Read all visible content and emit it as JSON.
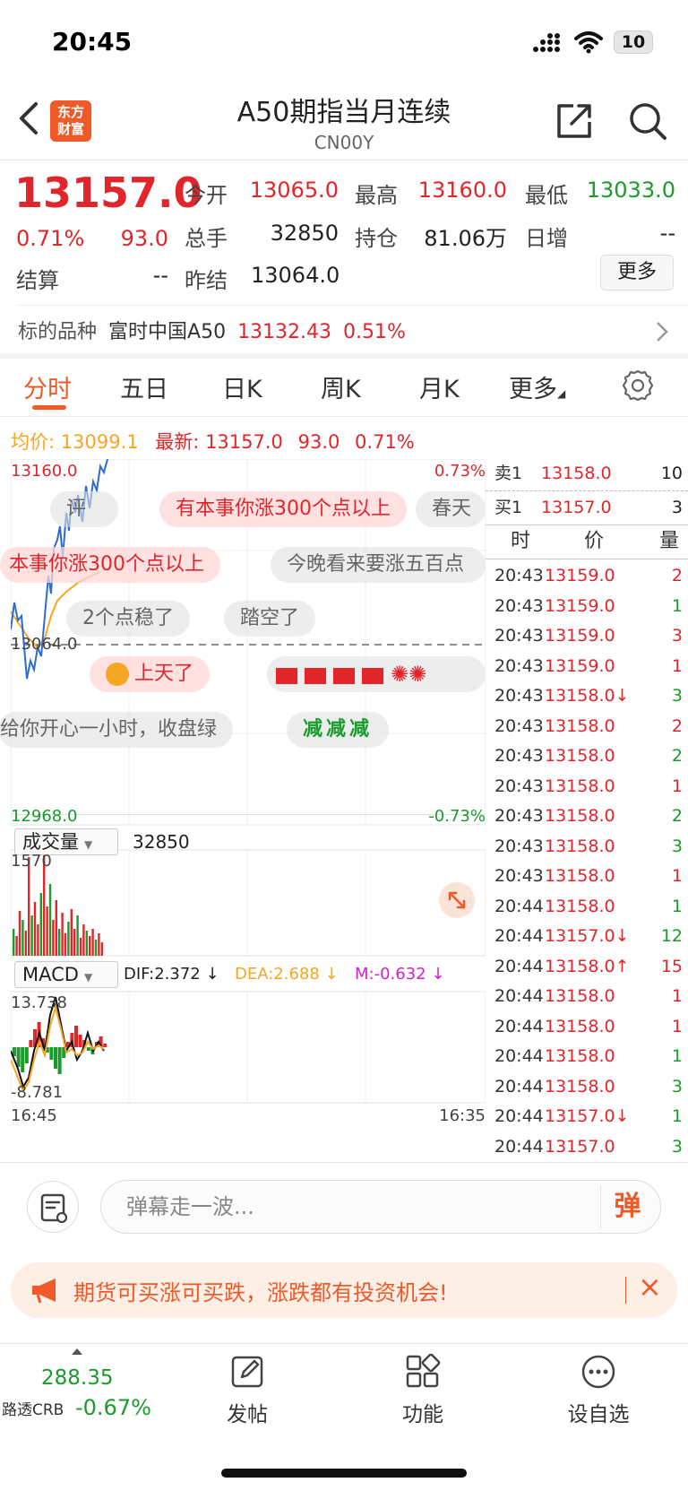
{
  "status": {
    "time": "20:45",
    "battery": "10"
  },
  "header": {
    "logo_line1": "东方",
    "logo_line2": "财富",
    "title": "A50期指当月连续",
    "code": "CN00Y"
  },
  "quote": {
    "last": "13157.0",
    "pct": "0.71%",
    "change": "93.0",
    "open_label": "今开",
    "open": "13065.0",
    "high_label": "最高",
    "high": "13160.0",
    "low_label": "最低",
    "low": "13033.0",
    "volume_label": "总手",
    "volume": "32850",
    "oi_label": "持仓",
    "oi": "81.06万",
    "daily_inc_label": "日增",
    "daily_inc": "--",
    "settle_label": "结算",
    "settle": "--",
    "prev_settle_label": "昨结",
    "prev_settle": "13064.0",
    "more": "更多"
  },
  "underlying": {
    "label": "标的品种",
    "name": "富时中国A50",
    "price": "13132.43",
    "pct": "0.51%"
  },
  "tabs": [
    "分时",
    "五日",
    "日K",
    "周K",
    "月K",
    "更多"
  ],
  "avg_row": {
    "avg_label": "均价:",
    "avg": "13099.1",
    "last_label": "最新:",
    "last": "13157.0",
    "change": "93.0",
    "pct": "0.71%"
  },
  "chart": {
    "ymax": "13160.0",
    "ymin": "12968.0",
    "prev": "13064.0",
    "pct_up": "0.73%",
    "pct_down": "-0.73%",
    "vol_selector": "成交量",
    "vol_total": "32850",
    "vol_max": "1570",
    "macd_selector": "MACD",
    "dif": "DIF:2.372 ↓",
    "dea": "DEA:2.688 ↓",
    "m": "M:-0.632 ↓",
    "macd_max": "13.738",
    "macd_min": "-8.781",
    "time_start": "16:45",
    "time_end": "16:35"
  },
  "danmu": [
    "有本事你涨300个点以上",
    "本事你涨300个点以上",
    "今晚看来要涨五百点",
    "2个点稳了",
    "踏空了",
    "上天了",
    "给你开心一小时，收盘绿",
    "春天",
    "减减减"
  ],
  "orderbook": {
    "sell_label": "卖1",
    "sell_price": "13158.0",
    "sell_vol": "10",
    "buy_label": "买1",
    "buy_price": "13157.0",
    "buy_vol": "3",
    "col_time": "时",
    "col_price": "价",
    "col_vol": "量",
    "trades": [
      {
        "t": "20:43",
        "p": "13159.0",
        "v": "2",
        "c": "red"
      },
      {
        "t": "20:43",
        "p": "13159.0",
        "v": "1",
        "c": "green"
      },
      {
        "t": "20:43",
        "p": "13159.0",
        "v": "3",
        "c": "red"
      },
      {
        "t": "20:43",
        "p": "13159.0",
        "v": "1",
        "c": "red"
      },
      {
        "t": "20:43",
        "p": "13158.0↓",
        "v": "3",
        "c": "green"
      },
      {
        "t": "20:43",
        "p": "13158.0",
        "v": "2",
        "c": "red"
      },
      {
        "t": "20:43",
        "p": "13158.0",
        "v": "2",
        "c": "green"
      },
      {
        "t": "20:43",
        "p": "13158.0",
        "v": "1",
        "c": "red"
      },
      {
        "t": "20:43",
        "p": "13158.0",
        "v": "2",
        "c": "green"
      },
      {
        "t": "20:43",
        "p": "13158.0",
        "v": "3",
        "c": "green"
      },
      {
        "t": "20:43",
        "p": "13158.0",
        "v": "1",
        "c": "red"
      },
      {
        "t": "20:44",
        "p": "13158.0",
        "v": "1",
        "c": "green"
      },
      {
        "t": "20:44",
        "p": "13157.0↓",
        "v": "12",
        "c": "green"
      },
      {
        "t": "20:44",
        "p": "13158.0↑",
        "v": "15",
        "c": "red"
      },
      {
        "t": "20:44",
        "p": "13158.0",
        "v": "1",
        "c": "red"
      },
      {
        "t": "20:44",
        "p": "13158.0",
        "v": "1",
        "c": "red"
      },
      {
        "t": "20:44",
        "p": "13158.0",
        "v": "1",
        "c": "green"
      },
      {
        "t": "20:44",
        "p": "13158.0",
        "v": "3",
        "c": "green"
      },
      {
        "t": "20:44",
        "p": "13157.0↓",
        "v": "1",
        "c": "green"
      },
      {
        "t": "20:44",
        "p": "13157.0",
        "v": "3",
        "c": "green"
      }
    ]
  },
  "comment": {
    "placeholder": "弹幕走一波...",
    "dan": "弹"
  },
  "banner": {
    "text": "期货可买涨可买跌，涨跌都有投资机会!"
  },
  "tabbar": {
    "index_value": "288.35",
    "index_name": "路透CRB",
    "index_pct": "-0.67%",
    "post": "发帖",
    "func": "功能",
    "watch": "设自选"
  }
}
